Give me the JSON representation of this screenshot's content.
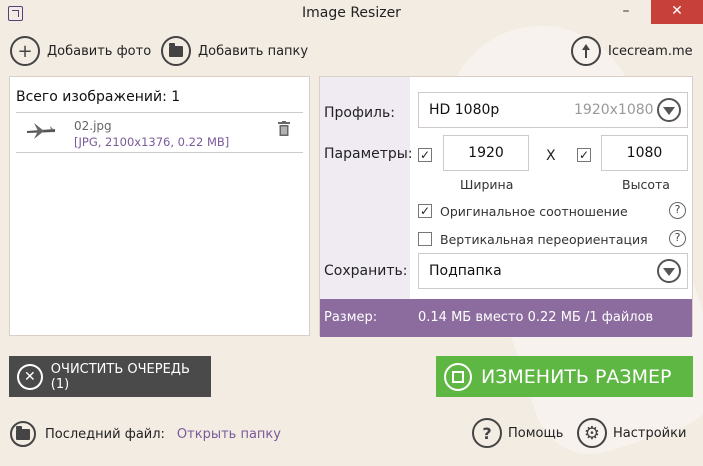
{
  "window": {
    "title": "Image Resizer",
    "minimize": "–",
    "close": "✕"
  },
  "toolbar": {
    "add_photo": "Добавить фото",
    "add_folder": "Добавить папку",
    "brand": "Icecream.me"
  },
  "queue": {
    "total_label": "Всего изображений: 1",
    "files": [
      {
        "name": "02.jpg",
        "info": "[JPG, 2100x1376, 0.22 MB]"
      }
    ]
  },
  "settings": {
    "profile_label": "Профиль:",
    "profile_value": "HD 1080p",
    "profile_dims": "1920x1080",
    "params_label": "Параметры:",
    "width_value": "1920",
    "height_value": "1080",
    "x_sep": "X",
    "width_label": "Ширина",
    "height_label": "Высота",
    "keep_ratio_label": "Оригинальное соотношение",
    "keep_ratio_checked": true,
    "vertical_label": "Вертикальная переориентация",
    "vertical_checked": false,
    "save_label": "Сохранить:",
    "save_value": "Подпапка",
    "size_label": "Размер:",
    "size_value": "0.14 МБ вместо 0.22 МБ /1 файлов"
  },
  "actions": {
    "clear_queue": "ОЧИСТИТЬ ОЧЕРЕДЬ (1)",
    "resize": "ИЗМЕНИТЬ РАЗМЕР"
  },
  "footer": {
    "last_file_label": "Последний файл:",
    "open_folder": "Открыть папку",
    "help": "Помощь",
    "settings": "Настройки"
  },
  "colors": {
    "accent_purple": "#8c6c9e",
    "resize_green": "#5fb743",
    "clear_dark": "#4a4a4a",
    "close_red": "#c7403a",
    "background": "#f3ece3"
  }
}
